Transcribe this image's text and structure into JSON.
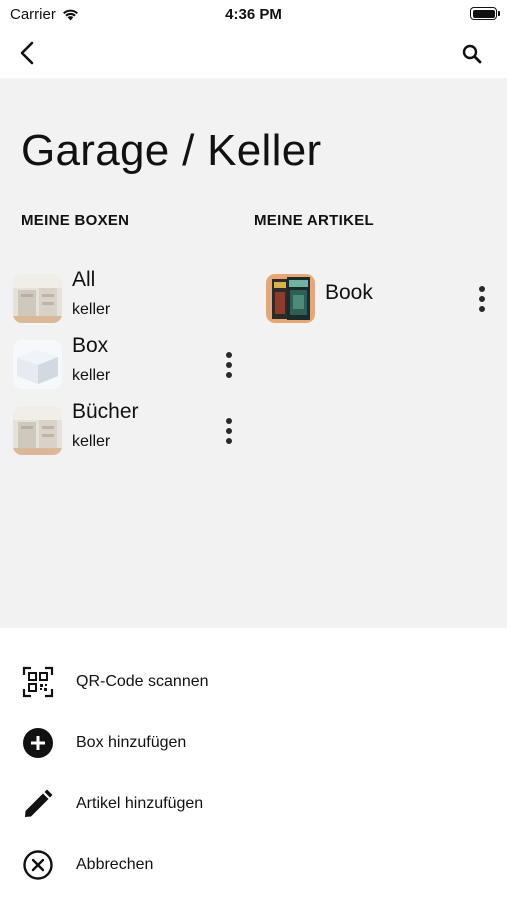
{
  "status_bar": {
    "carrier": "Carrier",
    "time": "4:36 PM"
  },
  "nav": {
    "back_icon": "chevron-left-icon",
    "search_icon": "search-icon"
  },
  "page": {
    "title": "Garage / Keller"
  },
  "boxes": {
    "header": "MEINE BOXEN",
    "items": [
      {
        "title": "All",
        "subtitle": "keller",
        "has_menu": false
      },
      {
        "title": "Box",
        "subtitle": "keller",
        "has_menu": true
      },
      {
        "title": "Bücher",
        "subtitle": "keller",
        "has_menu": true
      }
    ]
  },
  "articles": {
    "header": "MEINE ARTIKEL",
    "items": [
      {
        "title": "Book",
        "has_menu": true
      }
    ]
  },
  "actions": [
    {
      "label": "QR-Code scannen",
      "icon": "qr-code-icon"
    },
    {
      "label": "Box hinzufügen",
      "icon": "add-circle-icon"
    },
    {
      "label": "Artikel hinzufügen",
      "icon": "pencil-icon"
    },
    {
      "label": "Abbrechen",
      "icon": "cancel-circle-icon"
    }
  ],
  "colors": {
    "content_background": "#f2f2f2",
    "sheet_background": "#ffffff",
    "text": "#111111"
  }
}
